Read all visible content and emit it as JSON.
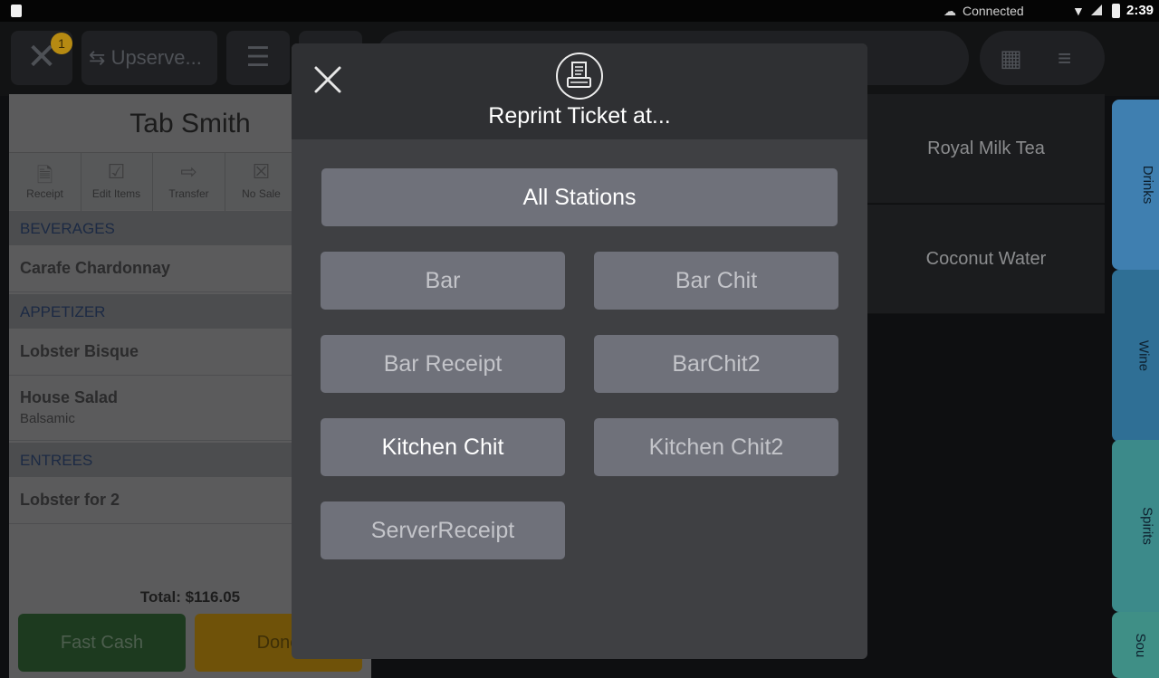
{
  "status_bar": {
    "connection": "Connected",
    "time": "2:39"
  },
  "toolbar": {
    "badge_count": "1",
    "upserve_label": "Upserve..."
  },
  "ticket": {
    "title": "Tab Smith",
    "actions": [
      {
        "label": "Receipt",
        "icon": "receipt-icon"
      },
      {
        "label": "Edit Items",
        "icon": "edit-items-icon"
      },
      {
        "label": "Transfer",
        "icon": "transfer-icon"
      },
      {
        "label": "No Sale",
        "icon": "no-sale-icon"
      }
    ],
    "sections": [
      {
        "name": "BEVERAGES",
        "items": [
          {
            "name": "Carafe Chardonnay",
            "modifier": ""
          }
        ]
      },
      {
        "name": "APPETIZER",
        "items": [
          {
            "name": "Lobster Bisque",
            "modifier": ""
          },
          {
            "name": "House Salad",
            "modifier": "Balsamic"
          }
        ]
      },
      {
        "name": "ENTREES",
        "items": [
          {
            "name": "Lobster for 2",
            "modifier": ""
          }
        ]
      }
    ],
    "total": "Total: $116.05",
    "fast_cash_label": "Fast Cash",
    "done_label": "Done"
  },
  "menu": {
    "items": [
      "Royal Milk Tea",
      "Coconut Water"
    ],
    "tabs": [
      {
        "label": "Drinks",
        "color": "#3f7fb0"
      },
      {
        "label": "Wine",
        "color": "#2f6f95"
      },
      {
        "label": "Spirits",
        "color": "#3c8a8a"
      },
      {
        "label": "Sou",
        "color": "#3f8f86"
      }
    ]
  },
  "modal": {
    "title": "Reprint Ticket at...",
    "all_stations_label": "All Stations",
    "stations": [
      "Bar",
      "Bar Chit",
      "Bar Receipt",
      "BarChit2",
      "Kitchen Chit",
      "Kitchen Chit2",
      "ServerReceipt"
    ]
  }
}
